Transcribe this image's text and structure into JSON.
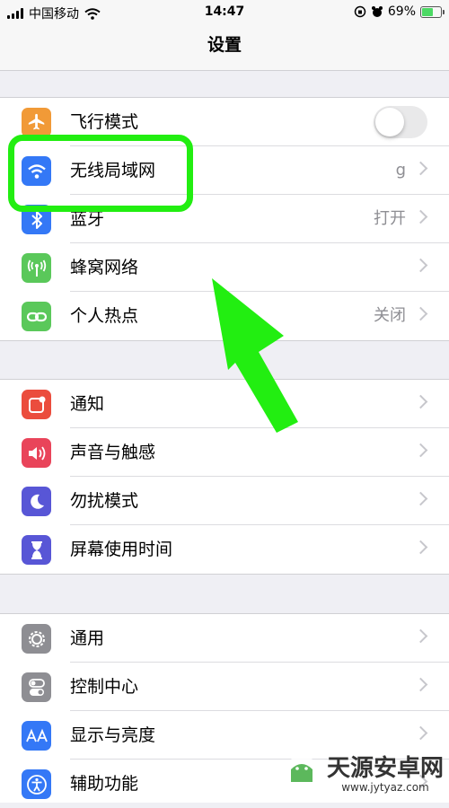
{
  "status_bar": {
    "carrier": "中国移动",
    "time": "14:47",
    "battery": "69%",
    "battery_level": 0.69
  },
  "nav": {
    "title": "设置"
  },
  "groups": [
    {
      "items": [
        {
          "label": "飞行模式",
          "value": "",
          "icon": "airplane-icon",
          "color": "#f19a37",
          "control": "toggle",
          "toggle_on": false
        },
        {
          "label": "无线局域网",
          "value": "g",
          "icon": "wifi-icon",
          "color": "#3478f6"
        },
        {
          "label": "蓝牙",
          "value": "打开",
          "icon": "bluetooth-icon",
          "color": "#3478f6"
        },
        {
          "label": "蜂窝网络",
          "value": "",
          "icon": "cellular-antenna-icon",
          "color": "#5ac85a"
        },
        {
          "label": "个人热点",
          "value": "关闭",
          "icon": "hotspot-link-icon",
          "color": "#5ac85a"
        }
      ]
    },
    {
      "items": [
        {
          "label": "通知",
          "value": "",
          "icon": "notifications-icon",
          "color": "#eb4d3d"
        },
        {
          "label": "声音与触感",
          "value": "",
          "icon": "speaker-icon",
          "color": "#e9445a"
        },
        {
          "label": "勿扰模式",
          "value": "",
          "icon": "moon-icon",
          "color": "#5856d6"
        },
        {
          "label": "屏幕使用时间",
          "value": "",
          "icon": "hourglass-icon",
          "color": "#5856d6"
        }
      ]
    },
    {
      "items": [
        {
          "label": "通用",
          "value": "",
          "icon": "gear-icon",
          "color": "#8e8e93"
        },
        {
          "label": "控制中心",
          "value": "",
          "icon": "control-center-icon",
          "color": "#8e8e93"
        },
        {
          "label": "显示与亮度",
          "value": "",
          "icon": "display-aa-icon",
          "color": "#3478f6"
        },
        {
          "label": "辅助功能",
          "value": "",
          "icon": "accessibility-icon",
          "color": "#3478f6"
        }
      ]
    }
  ],
  "watermark": {
    "name": "天源安卓网",
    "url": "www.jytyaz.com"
  }
}
